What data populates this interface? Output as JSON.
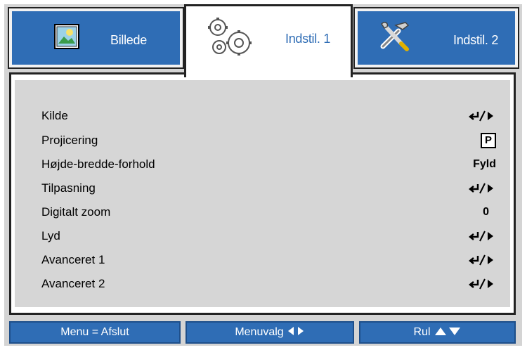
{
  "tabs": [
    {
      "label": "Billede",
      "icon": "picture-icon",
      "active": false
    },
    {
      "label": "Indstil. 1",
      "icon": "gears-icon",
      "active": true
    },
    {
      "label": "Indstil. 2",
      "icon": "tools-icon",
      "active": false
    }
  ],
  "menu": {
    "items": [
      {
        "label": "Kilde",
        "value_icon": "enter-arrow-icon"
      },
      {
        "label": "Projicering",
        "value": "P"
      },
      {
        "label": "Højde-bredde-forhold",
        "value": "Fyld"
      },
      {
        "label": "Tilpasning",
        "value_icon": "enter-arrow-icon"
      },
      {
        "label": "Digitalt zoom",
        "value": "0"
      },
      {
        "label": "Lyd",
        "value_icon": "enter-arrow-icon"
      },
      {
        "label": "Avanceret 1",
        "value_icon": "enter-arrow-icon"
      },
      {
        "label": "Avanceret 2",
        "value_icon": "enter-arrow-icon"
      }
    ]
  },
  "footer": {
    "menu_exit": "Menu = Afslut",
    "menu_select": "Menuvalg",
    "scroll": "Rul"
  },
  "colors": {
    "accent": "#2f6db5",
    "frame": "#d4d4d4",
    "panel_bg": "#d6d6d6"
  }
}
